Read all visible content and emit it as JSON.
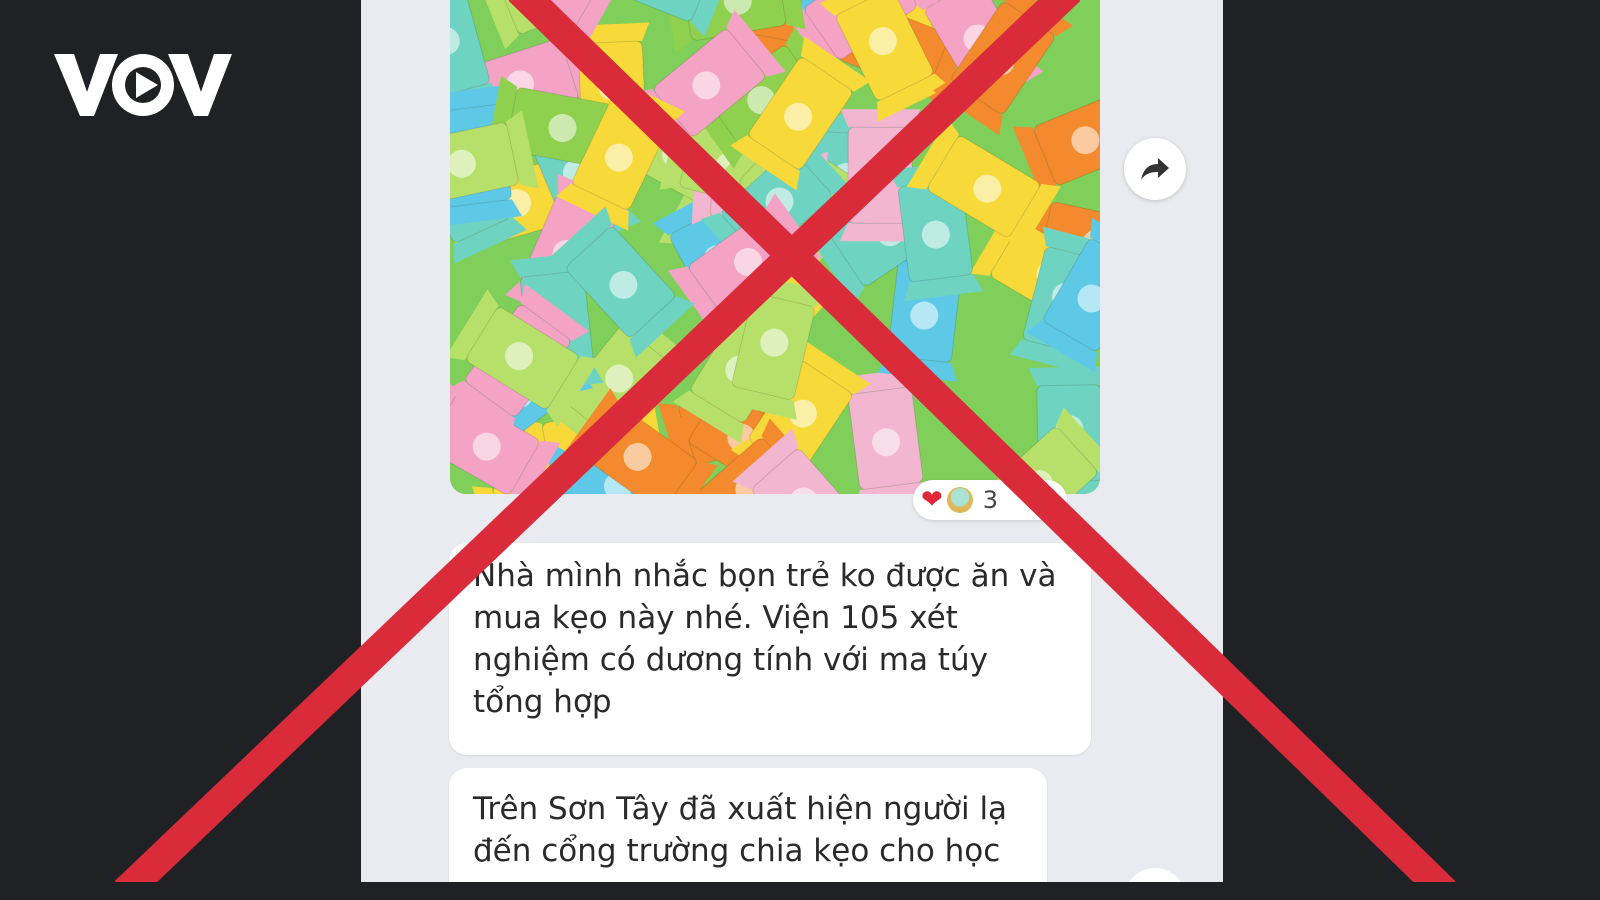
{
  "logo": {
    "text": "VOV"
  },
  "chat": {
    "image_message": {
      "alt": "candy-wrappers-photo"
    },
    "reactions": {
      "emoji_1": "❤",
      "emoji_2": "😇",
      "count": "3",
      "emoji_3": "❤"
    },
    "messages": [
      {
        "text": "Nhà mình nhắc bọn trẻ ko được ăn và\nmua kẹo này nhé. Viện 105 xét\nnghiệm có dương tính với ma túy\ntổng hợp"
      },
      {
        "text": "Trên Sơn Tây đã xuất hiện người lạ\nđến cổng trường chia kẹo cho học"
      }
    ]
  },
  "overlay": {
    "mark": "cross-out",
    "color": "#d92b3a"
  },
  "colors": {
    "background": "#202124",
    "panel": "#e9ebf0",
    "bubble": "#ffffff",
    "red": "#d92b3a"
  },
  "icons": {
    "share": "share-arrow-icon",
    "logo_play": "play-triangle-icon"
  }
}
